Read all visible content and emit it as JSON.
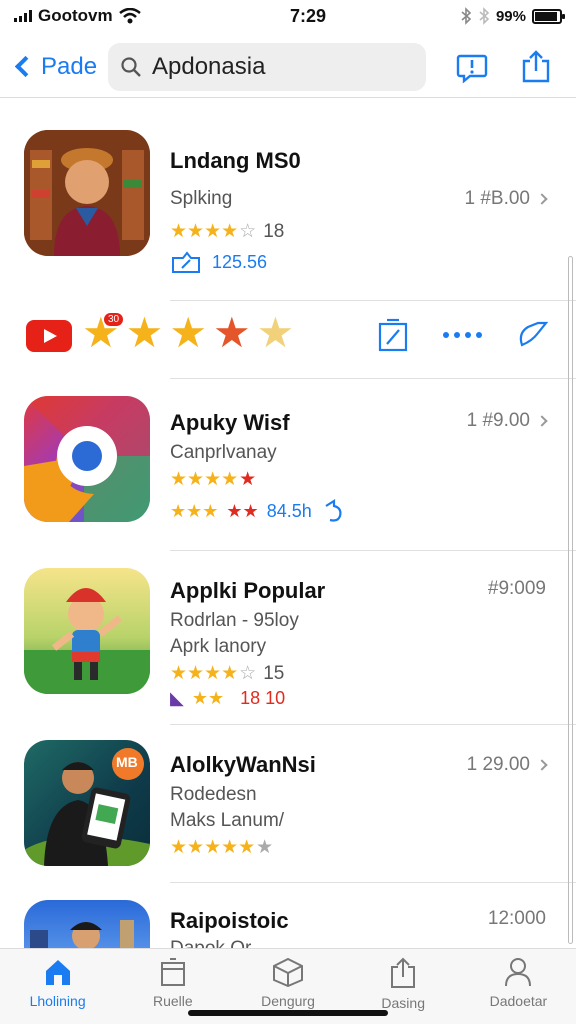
{
  "status": {
    "carrier": "Gootovm",
    "time": "7:29",
    "battery": "99%",
    "battery_level": 0.9
  },
  "nav": {
    "back_label": "Pade",
    "search_value": "Apdonasia"
  },
  "apps": [
    {
      "name": "Lndang MS0",
      "subtitle": "Splking",
      "price": "1 #B.00",
      "rating_count": "18",
      "extra": "125.56",
      "icon": "shopkeeper-icon"
    },
    {
      "name": "Apuky Wisf",
      "subtitle": "Canprlvanay",
      "price": "1 #9.00",
      "extra": "84.5h",
      "icon": "browser-icon"
    },
    {
      "name": "Applki Popular",
      "subtitle": "Rodrlan - 95loy",
      "subtitle2": "Aprk lanory",
      "price": "#9:009",
      "rating_count": "15",
      "extra": "18 10",
      "icon": "cartoon-character-icon"
    },
    {
      "name": "AlolkyWanNsi",
      "subtitle": "Rodedesn",
      "subtitle2": "Maks Lanum/",
      "price": "1 29.00",
      "badge": "MB",
      "icon": "phone-user-icon"
    },
    {
      "name": "Raipoistoic",
      "subtitle": "Dapok Qr",
      "price": "12:000",
      "icon": "city-photo-icon"
    }
  ],
  "promo": {
    "badge": "30"
  },
  "tabs": [
    {
      "label": "Lholining",
      "icon": "home-icon"
    },
    {
      "label": "Ruelle",
      "icon": "box-icon"
    },
    {
      "label": "Dengurg",
      "icon": "cube-icon"
    },
    {
      "label": "Dasing",
      "icon": "share-icon"
    },
    {
      "label": "Dadoetar",
      "icon": "person-icon"
    }
  ],
  "colors": {
    "accent": "#1a7cf0",
    "star": "#f5b21b",
    "youtube_red": "#e62117"
  }
}
